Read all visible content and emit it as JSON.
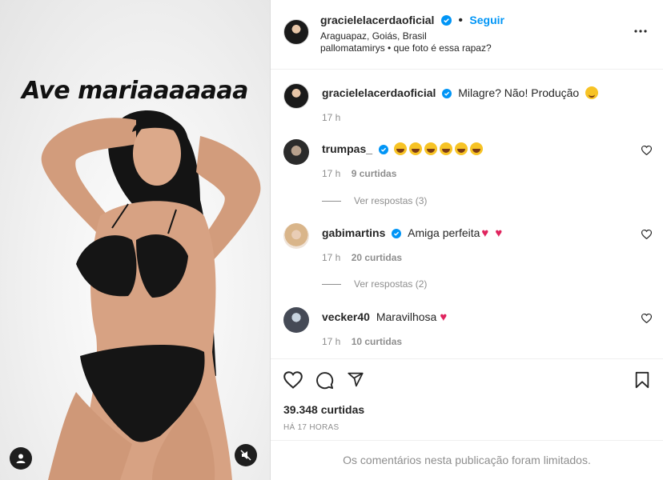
{
  "post": {
    "overlay_text": "Ave mariaaaaaaa",
    "author": "gracielelacerdaoficial",
    "follow_label": "Seguir",
    "location": "Araguapaz, Goiás, Brasil",
    "audio_line": "pallomatamirys • que foto é essa rapaz?"
  },
  "comments": [
    {
      "user": "gracielelacerdaoficial",
      "verified": true,
      "text": "Milagre? Não! Produção",
      "emoji": "smile",
      "time": "17 h",
      "likes": ""
    },
    {
      "user": "trumpas_",
      "verified": true,
      "text": "",
      "emoji": "laugh×6",
      "time": "17 h",
      "likes": "9 curtidas",
      "replies": "Ver respostas (3)"
    },
    {
      "user": "gabimartins",
      "verified": true,
      "text": "Amiga perfeita",
      "emoji": "red-heart×2",
      "time": "17 h",
      "likes": "20 curtidas",
      "replies": "Ver respostas (2)"
    },
    {
      "user": "vecker40",
      "verified": false,
      "text": "Maravilhosa",
      "emoji": "red-heart",
      "time": "17 h",
      "likes": "10 curtidas"
    }
  ],
  "footer": {
    "likes": "39.348 curtidas",
    "ago": "HÁ 17 HORAS",
    "limited": "Os comentários nesta publicação foram limitados."
  },
  "icons": [
    "more-icon",
    "verified-icon",
    "heart-icon",
    "comment-icon",
    "share-icon",
    "bookmark-icon",
    "user-tag-icon",
    "mute-icon"
  ],
  "colors": {
    "accent": "#0095f6",
    "verified": "#0095f6",
    "heart": "#e0245e",
    "muted": "#8e8e8e"
  }
}
